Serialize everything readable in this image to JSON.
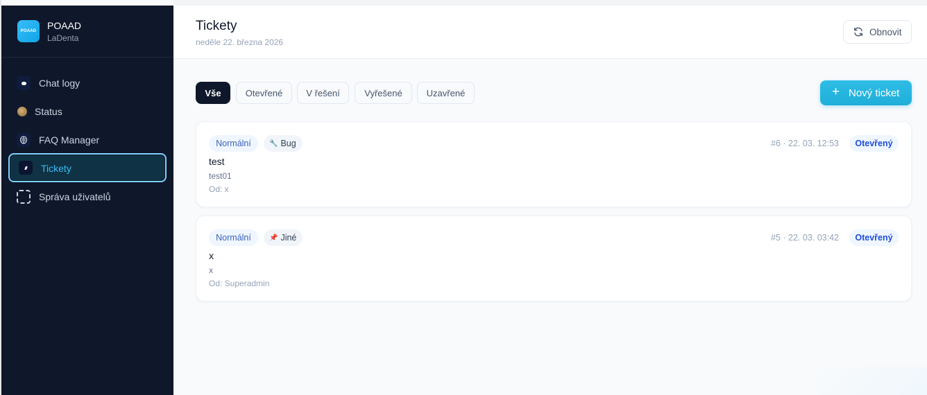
{
  "app": {
    "name": "POAAD",
    "tenant": "LaDenta",
    "logo_text": "POAAD"
  },
  "sidebar": {
    "items": [
      {
        "label": "Chat logy",
        "icon": "chat-icon"
      },
      {
        "label": "Status",
        "icon": "status-dot-icon"
      },
      {
        "label": "FAQ Manager",
        "icon": "brain-icon"
      },
      {
        "label": "Tickety",
        "icon": "ticket-icon",
        "active": true
      },
      {
        "label": "Správa uživatelů",
        "icon": "users-icon"
      }
    ]
  },
  "header": {
    "title": "Tickety",
    "date": "neděle 22. března 2026",
    "refresh_label": "Obnovit"
  },
  "filters": {
    "tabs": [
      {
        "label": "Vše",
        "active": true
      },
      {
        "label": "Otevřené"
      },
      {
        "label": "V řešení"
      },
      {
        "label": "Vyřešené"
      },
      {
        "label": "Uzavřené"
      }
    ],
    "new_ticket_label": "Nový ticket"
  },
  "tickets": [
    {
      "priority": "Normální",
      "category": "Bug",
      "category_icon": "bug-icon",
      "meta": "#6 · 22. 03. 12:53",
      "status": "Otevřený",
      "title": "test",
      "body": "test01",
      "from": "Od: x"
    },
    {
      "priority": "Normální",
      "category": "Jiné",
      "category_icon": "pin-icon",
      "meta": "#5 · 22. 03. 03:42",
      "status": "Otevřený",
      "title": "x",
      "body": "x",
      "from": "Od: Superadmin"
    }
  ],
  "colors": {
    "sidebar_bg": "#0f172a",
    "accent": "#1eaed8",
    "active_nav_border": "#7dd3fc",
    "status_blue": "#1d4ed8"
  }
}
